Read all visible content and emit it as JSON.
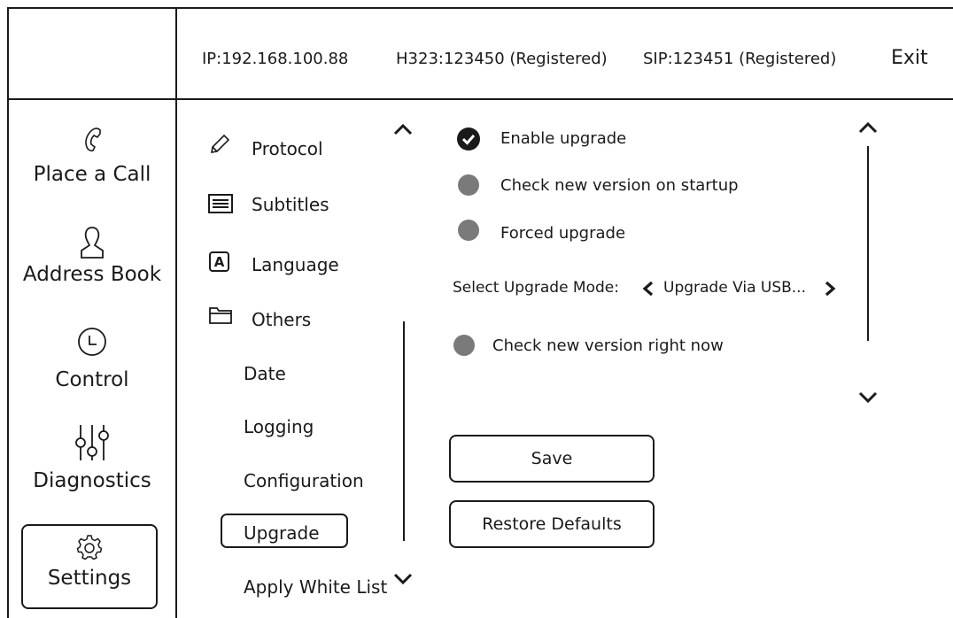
{
  "header": {
    "ip": "IP:192.168.100.88",
    "h323": "H323:123450 (Registered)",
    "sip": "SIP:123451 (Registered)",
    "exit_label": "Exit"
  },
  "sidebar": {
    "items": [
      {
        "label": "Place a Call",
        "icon": "phone-icon"
      },
      {
        "label": "Address Book",
        "icon": "person-icon"
      },
      {
        "label": "Control",
        "icon": "clock-icon"
      },
      {
        "label": "Diagnostics",
        "icon": "sliders-icon"
      },
      {
        "label": "Settings",
        "icon": "gear-icon",
        "selected": true
      }
    ]
  },
  "menu": {
    "items": [
      {
        "label": "Protocol",
        "icon": "pencil-icon"
      },
      {
        "label": "Subtitles",
        "icon": "lines-icon"
      },
      {
        "label": "Language",
        "icon": "language-a-icon"
      },
      {
        "label": "Others",
        "icon": "folder-icon"
      }
    ],
    "sub_items": [
      {
        "label": "Date"
      },
      {
        "label": "Logging"
      },
      {
        "label": "Configuration"
      },
      {
        "label": "Upgrade",
        "selected": true
      },
      {
        "label": "Apply White List"
      }
    ]
  },
  "options": {
    "enable_upgrade": {
      "label": "Enable upgrade",
      "checked": true
    },
    "check_on_startup": {
      "label": "Check new version on startup",
      "checked": false
    },
    "forced_upgrade": {
      "label": "Forced upgrade",
      "checked": false
    },
    "mode_label": "Select Upgrade Mode:",
    "mode_value": "Upgrade Via USB...",
    "check_now": {
      "label": "Check new version right now"
    }
  },
  "buttons": {
    "save": "Save",
    "restore": "Restore Defaults"
  }
}
